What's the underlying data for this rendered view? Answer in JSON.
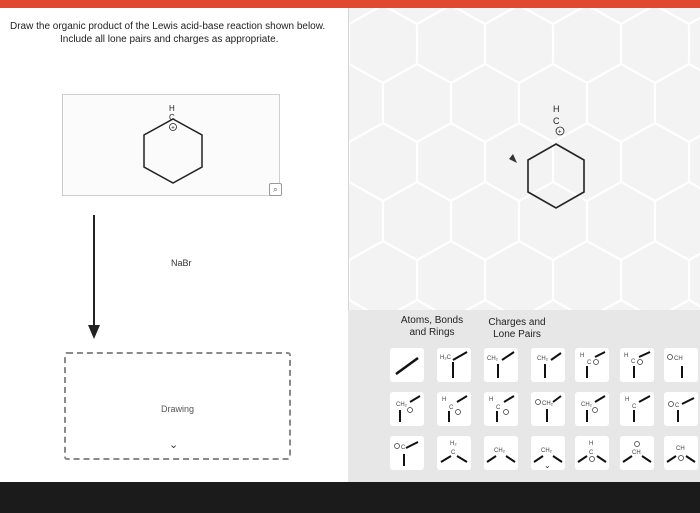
{
  "question": {
    "line1": "Draw the organic product of the Lewis acid-base reaction shown below.",
    "line2": "Include all lone pairs and charges as appropriate."
  },
  "reactant": {
    "atom_h": "H",
    "atom_c": "C",
    "charge": "+"
  },
  "reagent": "NaBr",
  "drawing_area": {
    "label": "Drawing"
  },
  "editor": {
    "molecule": {
      "atom_h": "H",
      "atom_c": "C",
      "charge": "+"
    },
    "tabs": [
      {
        "line1": "Atoms, Bonds",
        "line2": "and Rings"
      },
      {
        "line1": "Charges and",
        "line2": "Lone Pairs"
      }
    ]
  },
  "tool_glyphs": {
    "h_c": "H₂C",
    "ch2": "CH₂",
    "h": "H",
    "c": "C",
    "ch": "CH",
    "h2": "H₂",
    "ch3": "CH₃",
    "cl": "C"
  },
  "icons": [
    "zoom-icon",
    "chevron-down-icon",
    "reaction-arrow-icon"
  ]
}
